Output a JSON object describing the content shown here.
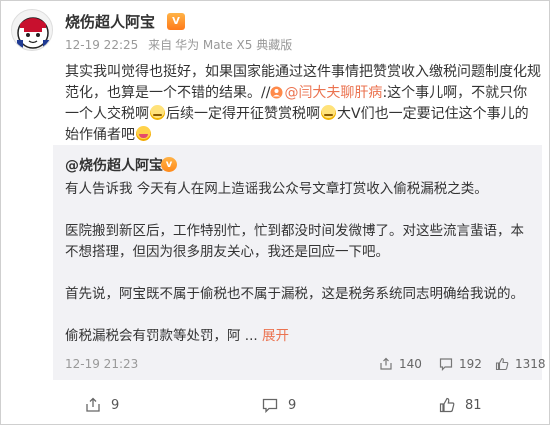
{
  "post": {
    "author": "烧伤超人阿宝",
    "badge": "V",
    "time": "12-19 22:25",
    "source_prefix": "来自",
    "source": "华为 Mate X5 典藏版",
    "text_part1": "其实我叫觉得也挺好，如果国家能通过这件事情把赞赏收入缴税问题制度化规范化，也算是一个不错的结果。//",
    "mention": "@闫大夫聊肝病",
    "text_part2": ":这个事儿啊，不就只你一个人交税啊",
    "text_part3": "后续一定得开征赞赏税啊",
    "text_part4": "大V们也一定要记住这个事儿的始作俑者吧"
  },
  "repost": {
    "author": "@烧伤超人阿宝",
    "badge": "v",
    "paragraphs": [
      "有人告诉我 今天有人在网上造谣我公众号文章打赏收入偷税漏税之类。",
      "医院搬到新区后，工作特别忙，忙到都没时间发微博了。对这些流言蜚语，本不想搭理，但因为很多朋友关心，我还是回应一下吧。",
      "首先说，阿宝既不属于偷税也不属于漏税，这是税务系统同志明确给我说的。"
    ],
    "last_line": "偷税漏税会有罚款等处罚，阿 ...",
    "expand": "展开",
    "time": "12-19 21:23",
    "reposts": "140",
    "comments": "192",
    "likes": "1318"
  },
  "toolbar": {
    "reposts": "9",
    "comments": "9",
    "likes": "81"
  },
  "colors": {
    "accent": "#eb7350",
    "repost_bg": "#f2f2f5",
    "meta": "#999999"
  }
}
